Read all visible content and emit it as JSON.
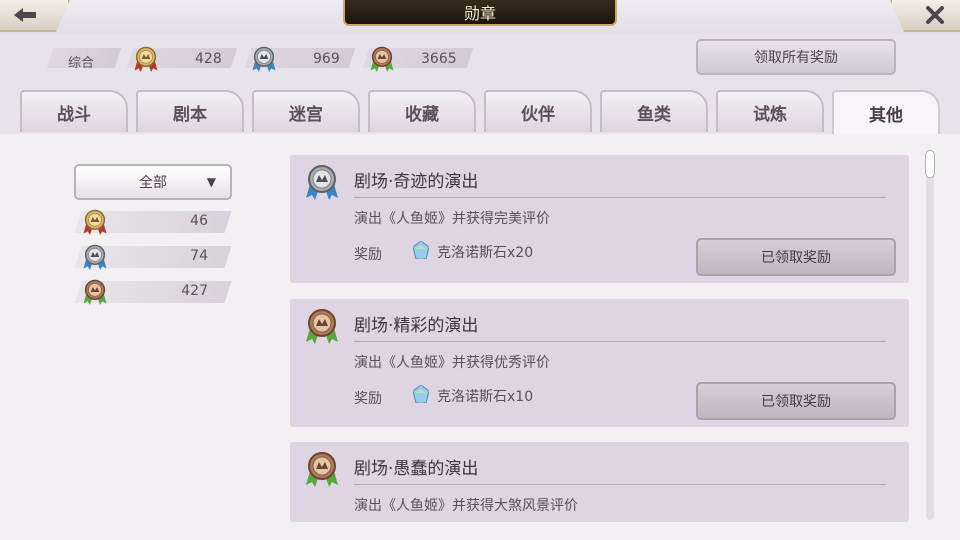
{
  "header": {
    "title": "勋章"
  },
  "summary": {
    "label": "综合",
    "gold": "428",
    "silver": "969",
    "bronze": "3665",
    "claim_all": "领取所有奖励"
  },
  "tabs": [
    {
      "label": "战斗"
    },
    {
      "label": "剧本"
    },
    {
      "label": "迷宫"
    },
    {
      "label": "收藏"
    },
    {
      "label": "伙伴"
    },
    {
      "label": "鱼类"
    },
    {
      "label": "试炼"
    },
    {
      "label": "其他",
      "active": true
    }
  ],
  "sidebar": {
    "filter": "全部",
    "gold": "46",
    "silver": "74",
    "bronze": "427"
  },
  "cards": [
    {
      "title": "剧场·奇迹的演出",
      "desc": "演出《人鱼姬》并获得完美评价",
      "reward_label": "奖励",
      "reward": "克洛诺斯石x20",
      "button": "已领取奖励",
      "medal": "silver"
    },
    {
      "title": "剧场·精彩的演出",
      "desc": "演出《人鱼姬》并获得优秀评价",
      "reward_label": "奖励",
      "reward": "克洛诺斯石x10",
      "button": "已领取奖励",
      "medal": "bronze"
    },
    {
      "title": "剧场·愚蠢的演出",
      "desc": "演出《人鱼姬》并获得大煞风景评价",
      "medal": "bronze"
    }
  ],
  "colors": {
    "gold_ribbon": "#b63a2e",
    "silver_ribbon": "#3a86c5",
    "bronze_ribbon": "#5aa640",
    "gold_medal": "#d9b46a",
    "silver_medal": "#a8acb0",
    "bronze_medal": "#b07a5a"
  },
  "icons": {
    "back": "arrow-left-icon",
    "close": "close-icon",
    "gem": "chronos-stone-icon"
  }
}
